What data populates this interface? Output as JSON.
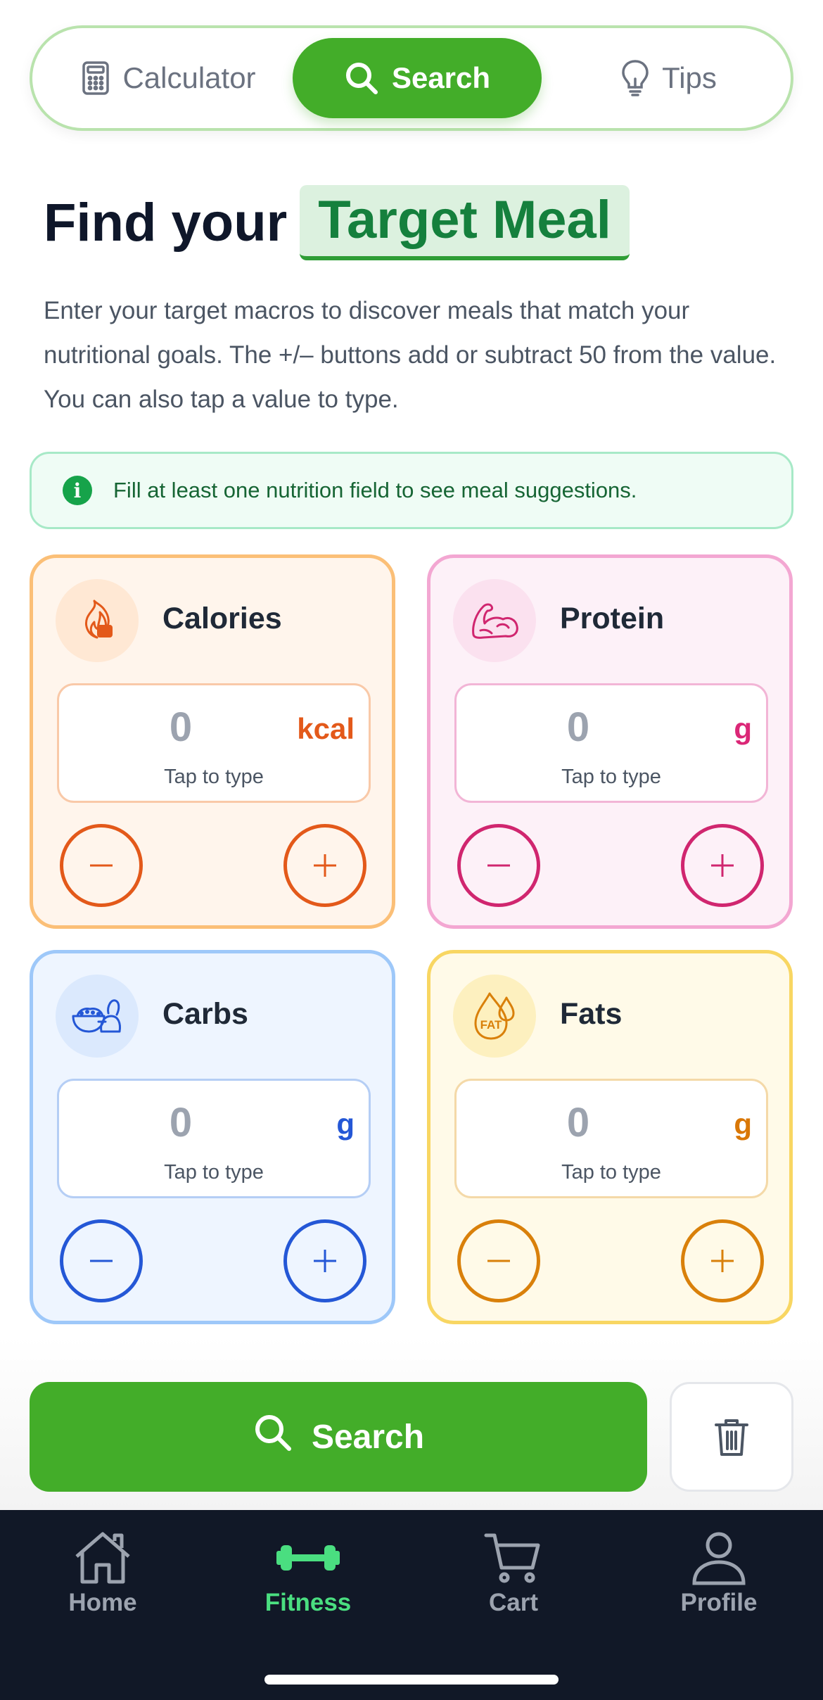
{
  "tabs": [
    {
      "label": "Calculator",
      "icon": "calculator-icon"
    },
    {
      "label": "Search",
      "icon": "search-icon",
      "active": true
    },
    {
      "label": "Tips",
      "icon": "lightbulb-icon"
    }
  ],
  "heading": {
    "prefix": "Find your",
    "highlight": "Target Meal"
  },
  "description": "Enter your target macros to discover meals that match your nutritional goals. The +/– buttons add or subtract 50 from the value. You can also tap a value to type.",
  "info": {
    "text": "Fill at least one nutrition field to see meal suggestions.",
    "icon": "info-icon"
  },
  "macros": [
    {
      "title": "Calories",
      "value": "0",
      "unit": "kcal",
      "hint": "Tap to type",
      "icon": "flame-icon",
      "color": "#e3591a"
    },
    {
      "title": "Protein",
      "value": "0",
      "unit": "g",
      "hint": "Tap to type",
      "icon": "muscle-icon",
      "color": "#d0266f"
    },
    {
      "title": "Carbs",
      "value": "0",
      "unit": "g",
      "hint": "Tap to type",
      "icon": "bread-bowl-icon",
      "color": "#2457d6"
    },
    {
      "title": "Fats",
      "value": "0",
      "unit": "g",
      "hint": "Tap to type",
      "icon": "fat-drop-icon",
      "icon_text": "FAT",
      "color": "#d9800a"
    }
  ],
  "actions": {
    "search_label": "Search"
  },
  "nav": [
    {
      "label": "Home",
      "icon": "home-icon"
    },
    {
      "label": "Fitness",
      "icon": "dumbbell-icon",
      "active": true
    },
    {
      "label": "Cart",
      "icon": "cart-icon"
    },
    {
      "label": "Profile",
      "icon": "profile-icon"
    }
  ],
  "colors": {
    "brand_green": "#43ad29",
    "nav_bg": "#111827",
    "nav_active": "#4ade80"
  }
}
